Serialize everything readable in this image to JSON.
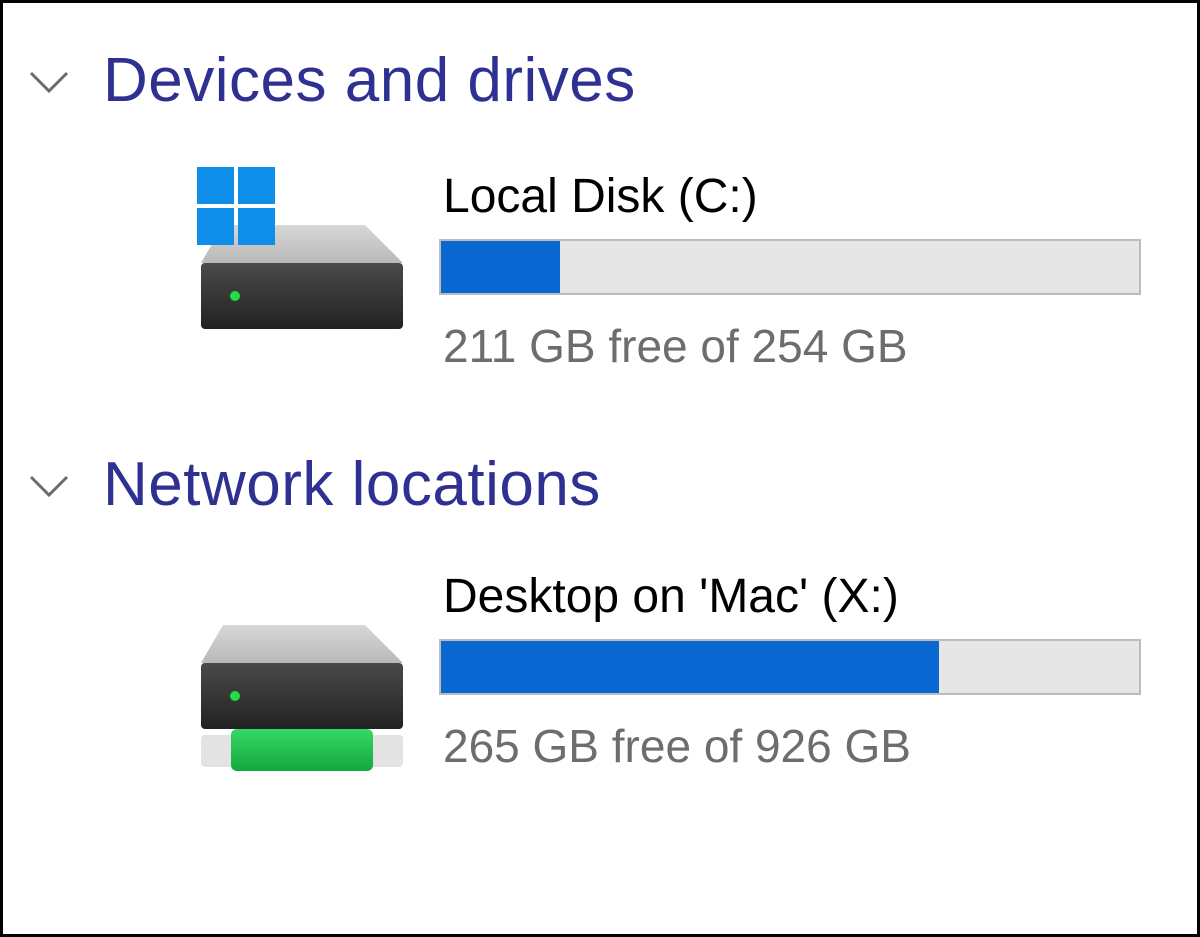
{
  "groups": [
    {
      "title": "Devices and drives",
      "drive": {
        "name": "Local Disk (C:)",
        "status": "211 GB free of 254 GB",
        "used_fraction": 0.17,
        "icon": "windows-drive-icon"
      }
    },
    {
      "title": "Network locations",
      "drive": {
        "name": "Desktop on 'Mac' (X:)",
        "status": "265 GB free of 926 GB",
        "used_fraction": 0.714,
        "icon": "network-drive-icon"
      }
    }
  ],
  "colors": {
    "group_title": "#2e3192",
    "bar_fill": "#0a66d1",
    "bar_track": "#e6e6e6",
    "windows_logo": "#0f8ee9",
    "led": "#22dd44",
    "network_band": "#1fbf4a"
  }
}
